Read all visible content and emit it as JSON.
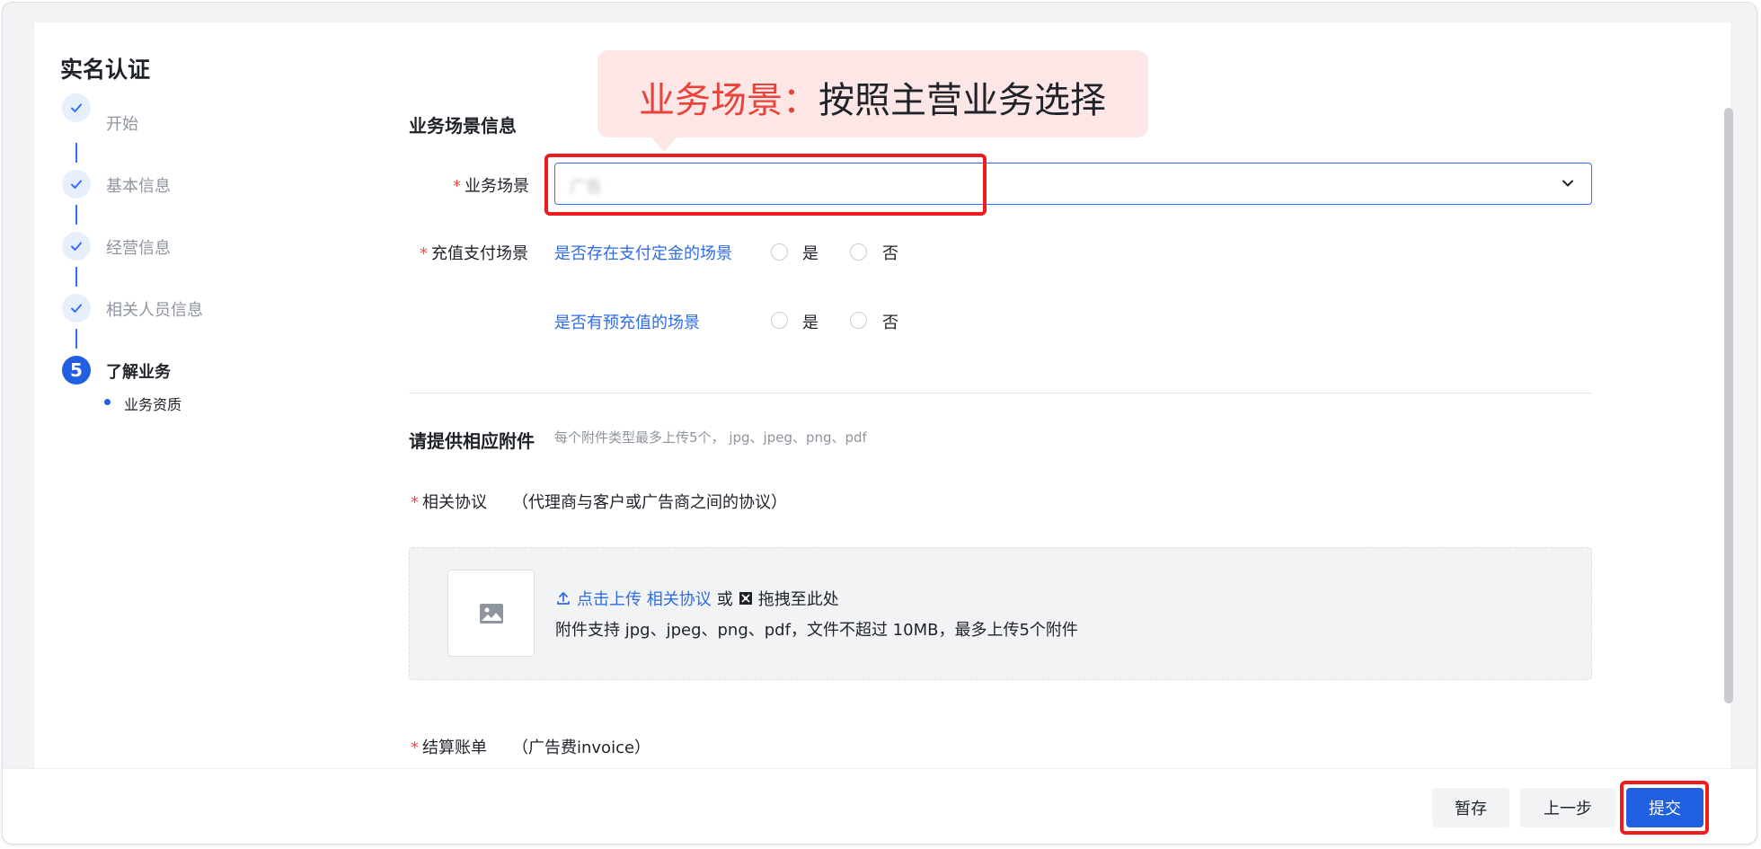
{
  "page": {
    "title": "实名认证"
  },
  "steps": [
    {
      "label": "开始",
      "status": "done"
    },
    {
      "label": "基本信息",
      "status": "done"
    },
    {
      "label": "经营信息",
      "status": "done"
    },
    {
      "label": "相关人员信息",
      "status": "done"
    },
    {
      "label": "了解业务",
      "status": "active",
      "number": "5"
    }
  ],
  "sub_step": {
    "label": "业务资质"
  },
  "section1": {
    "title": "业务场景信息",
    "required_mark": "*",
    "scene_label": "业务场景",
    "scene_value": "广告",
    "recharge_label": "充值支付场景",
    "q1": "是否存在支付定金的场景",
    "q2": "是否有预充值的场景",
    "yes": "是",
    "no": "否"
  },
  "section2": {
    "title": "请提供相应附件",
    "hint": "每个附件类型最多上传5个， jpg、jpeg、png、pdf",
    "agreement_label": "相关协议",
    "agreement_note": "（代理商与客户或广告商之间的协议）",
    "upload_click": "点击上传 相关协议",
    "upload_or": "或",
    "upload_drag": "拖拽至此处",
    "upload_desc": "附件支持 jpg、jpeg、png、pdf，文件不超过 10MB，最多上传5个附件",
    "settlement_label": "结算账单",
    "settlement_note": "（广告费invoice）"
  },
  "tooltip": {
    "title": "业务场景：",
    "desc": "按照主营业务选择"
  },
  "footer": {
    "save": "暂存",
    "prev": "上一步",
    "submit": "提交"
  },
  "colors": {
    "primary": "#1f5fe0",
    "link": "#2f6ce5",
    "highlight": "#ee1c1c",
    "tooltip_bg": "#fde7e6"
  },
  "icons": [
    "check-icon",
    "chevron-down-icon",
    "image-placeholder-icon",
    "upload-icon",
    "drag-icon"
  ]
}
